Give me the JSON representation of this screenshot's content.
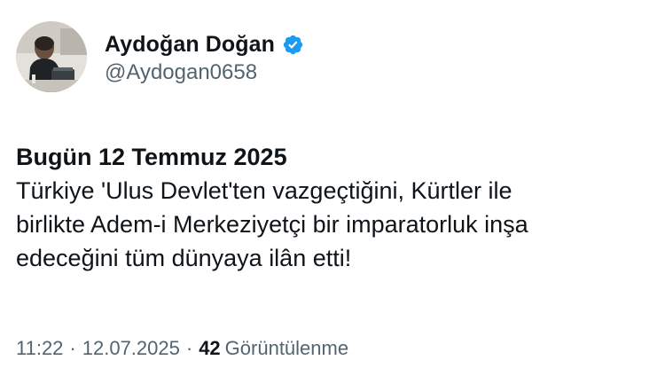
{
  "author": {
    "display_name": "Aydoğan Doğan",
    "handle": "@Aydogan0658",
    "verified_icon": "verified-badge-icon",
    "verified_color": "#1d9bf0"
  },
  "tweet": {
    "headline": "Bugün 12 Temmuz 2025",
    "body_lines": [
      "Türkiye 'Ulus Devlet'ten vazgeçtiğini, Kürtler ile",
      "birlikte Adem-i Merkeziyetçi bir imparatorluk inşa",
      "edeceğini tüm dünyaya ilân etti!"
    ]
  },
  "meta": {
    "time": "11:22",
    "separator": "·",
    "date": "12.07.2025",
    "views_count": "42",
    "views_label": "Görüntülenme"
  },
  "colors": {
    "text_primary": "#0f1419",
    "text_secondary": "#536471",
    "accent": "#1d9bf0"
  }
}
